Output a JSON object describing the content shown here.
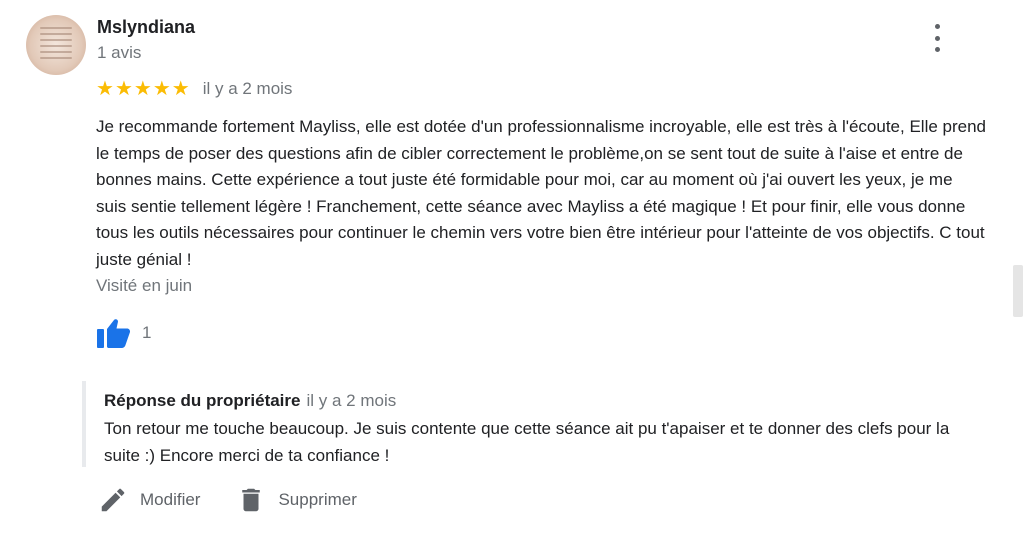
{
  "reviewer": {
    "name": "Mslyndiana",
    "reviews_count": "1 avis"
  },
  "review": {
    "stars": [
      "★",
      "★",
      "★",
      "★",
      "★"
    ],
    "star_color": "#fbbc04",
    "date": "il y a 2 mois",
    "text": "Je recommande fortement Mayliss, elle est dotée d'un professionnalisme incroyable, elle est très à l'écoute, Elle prend le temps de poser des questions afin de cibler correctement le problème,on se sent tout de suite à l'aise et entre de bonnes mains. Cette expérience a tout juste été formidable pour moi, car au moment où j'ai ouvert les yeux, je me suis sentie tellement légère ! Franchement, cette séance avec Mayliss a été magique ! Et pour finir, elle vous donne tous les outils nécessaires pour continuer le chemin vers votre bien être intérieur pour l'atteinte de vos objectifs. C tout  juste génial !",
    "visited": "Visité en juin",
    "likes": "1",
    "like_icon": "thumb-up-icon",
    "like_color": "#1a73e8"
  },
  "owner_reply": {
    "label": "Réponse du propriétaire",
    "date": "il y a 2 mois",
    "text": "Ton retour me touche beaucoup. Je suis contente que cette séance ait pu t'apaiser et te donner des clefs pour la suite :) Encore merci de ta confiance !"
  },
  "actions": {
    "edit_label": "Modifier",
    "edit_icon": "pencil-icon",
    "delete_label": "Supprimer",
    "delete_icon": "trash-icon"
  },
  "menu_icon": "more-vert-icon"
}
